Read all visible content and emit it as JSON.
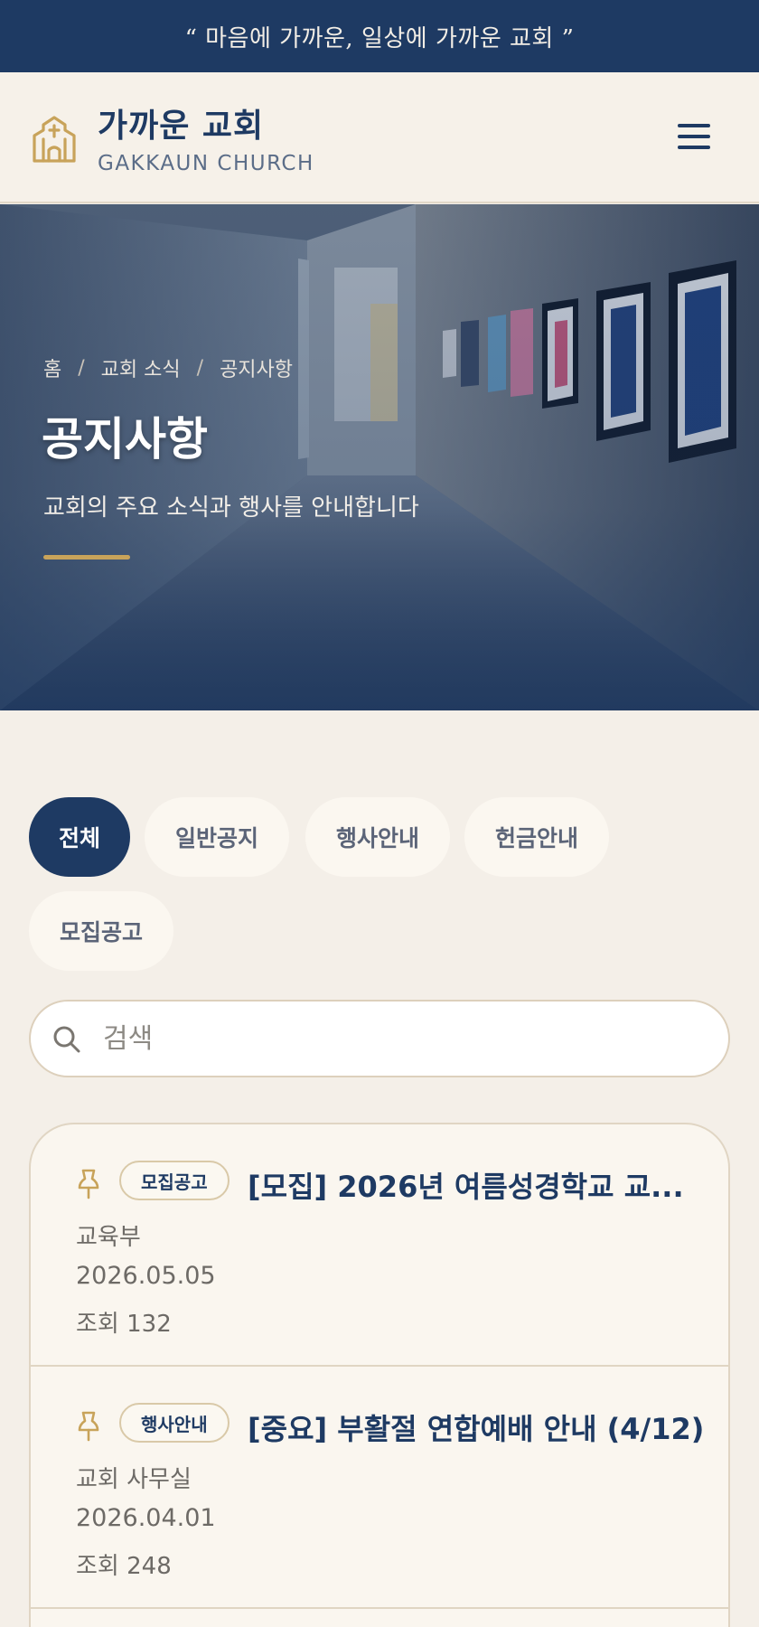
{
  "banner": {
    "text": "“ 마음에 가까운, 일상에 가까운 교회 ”"
  },
  "header": {
    "logo_icon": "church-icon",
    "brand_name": "가까운 교회",
    "brand_sub": "GAKKAUN CHURCH",
    "menu_icon": "hamburger-menu-icon"
  },
  "hero": {
    "breadcrumb": [
      "홈",
      "교회 소식",
      "공지사항"
    ],
    "breadcrumb_separator": "/",
    "title": "공지사항",
    "description": "교회의 주요 소식과 행사를 안내합니다"
  },
  "filters": {
    "chips": [
      {
        "label": "전체",
        "active": true
      },
      {
        "label": "일반공지",
        "active": false
      },
      {
        "label": "행사안내",
        "active": false
      },
      {
        "label": "헌금안내",
        "active": false
      },
      {
        "label": "모집공고",
        "active": false
      }
    ]
  },
  "search": {
    "placeholder": "검색",
    "value": "",
    "icon": "search-icon"
  },
  "notices": [
    {
      "pinned": true,
      "tag": "모집공고",
      "title": "[모집] 2026년 여름성경학교 교...",
      "author": "교육부",
      "date": "2026.05.05",
      "views": "조회 132"
    },
    {
      "pinned": true,
      "tag": "행사안내",
      "title": "[중요] 부활절 연합예배 안내 (4/12)",
      "author": "교회 사무실",
      "date": "2026.04.01",
      "views": "조회 248"
    }
  ],
  "colors": {
    "navy": "#1e3a63",
    "gold": "#c8a35a",
    "background": "#f4efe8",
    "card": "#faf6ef"
  }
}
